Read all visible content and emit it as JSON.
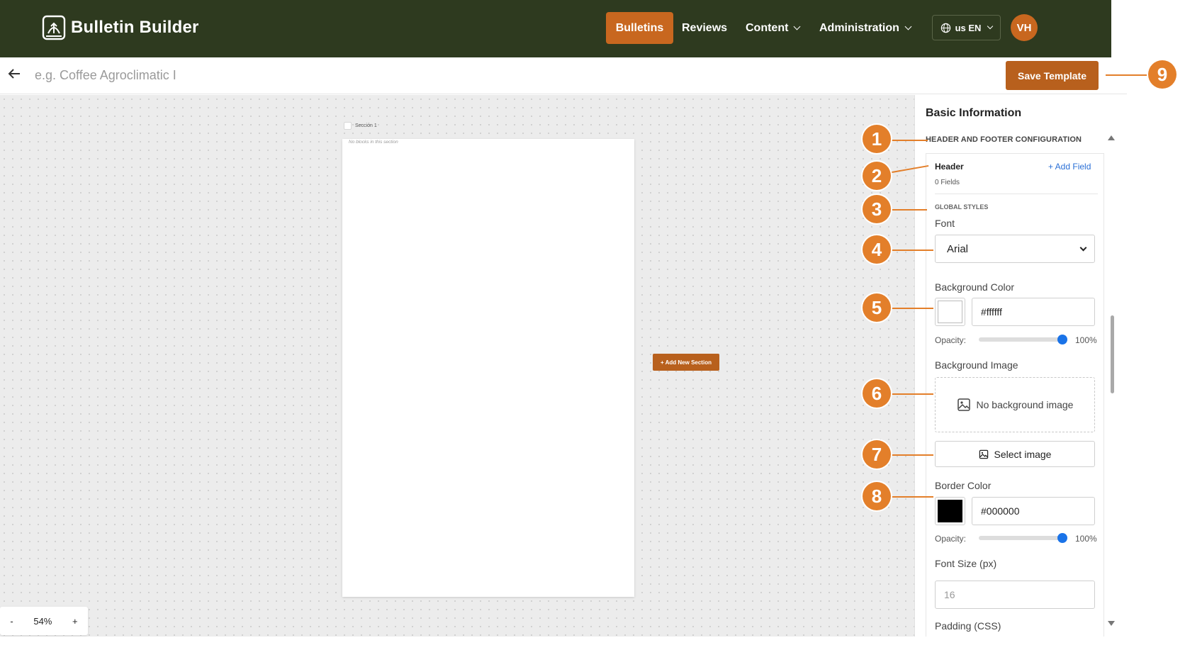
{
  "app": {
    "brand": "Bulletin Builder",
    "nav": {
      "bulletins": "Bulletins",
      "reviews": "Reviews",
      "content": "Content",
      "administration": "Administration"
    },
    "language": "us EN",
    "user_initials": "VH"
  },
  "toolbar": {
    "title_placeholder": "e.g. Coffee Agroclimatic I",
    "save_label": "Save Template"
  },
  "canvas": {
    "section_label": "Sección 1",
    "empty_section_text": "No blocks in this section",
    "add_section_label": "+ Add New Section",
    "zoom": {
      "minus": "-",
      "level": "54%",
      "plus": "+"
    }
  },
  "panel": {
    "title": "Basic Information",
    "section_heading": "HEADER AND FOOTER CONFIGURATION",
    "header": {
      "label": "Header",
      "add_field": "+ Add Field",
      "fields_count": "0 Fields"
    },
    "global_styles": "GLOBAL STYLES",
    "font": {
      "label": "Font",
      "value": "Arial"
    },
    "background_color": {
      "label": "Background Color",
      "hex": "#ffffff",
      "opacity_label": "Opacity:",
      "opacity_value": "100%",
      "opacity_fraction": 1.0
    },
    "background_image": {
      "label": "Background Image",
      "empty_text": "No background image",
      "select_label": "Select image"
    },
    "border_color": {
      "label": "Border Color",
      "hex": "#000000",
      "opacity_label": "Opacity:",
      "opacity_value": "100%",
      "opacity_fraction": 1.0
    },
    "font_size": {
      "label": "Font Size (px)",
      "placeholder": "16"
    },
    "padding": {
      "label": "Padding (CSS)"
    }
  },
  "callouts": [
    "1",
    "2",
    "3",
    "4",
    "5",
    "6",
    "7",
    "8",
    "9"
  ],
  "colors": {
    "topbar": "#2e3a1f",
    "accent": "#c8671f",
    "callout": "#e37f2a",
    "link": "#2a6fd6",
    "slider": "#1a73e8"
  },
  "icons": {
    "brand": "bulletin-logo-icon",
    "globe": "globe-icon",
    "back": "arrow-left-icon",
    "image": "image-icon"
  }
}
